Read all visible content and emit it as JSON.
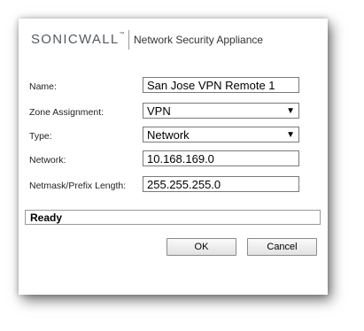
{
  "header": {
    "logo_text": "SONICWALL",
    "logo_mark": "™",
    "title": "Network Security Appliance"
  },
  "form": {
    "name": {
      "label": "Name:",
      "value": "San Jose VPN Remote 1"
    },
    "zone": {
      "label": "Zone Assignment:",
      "value": "VPN"
    },
    "type": {
      "label": "Type:",
      "value": "Network"
    },
    "network": {
      "label": "Network:",
      "value": "10.168.169.0"
    },
    "netmask": {
      "label": "Netmask/Prefix Length:",
      "value": "255.255.255.0"
    }
  },
  "status": {
    "text": "Ready"
  },
  "buttons": {
    "ok": "OK",
    "cancel": "Cancel"
  },
  "icons": {
    "dropdown": "chevron-down-icon"
  }
}
